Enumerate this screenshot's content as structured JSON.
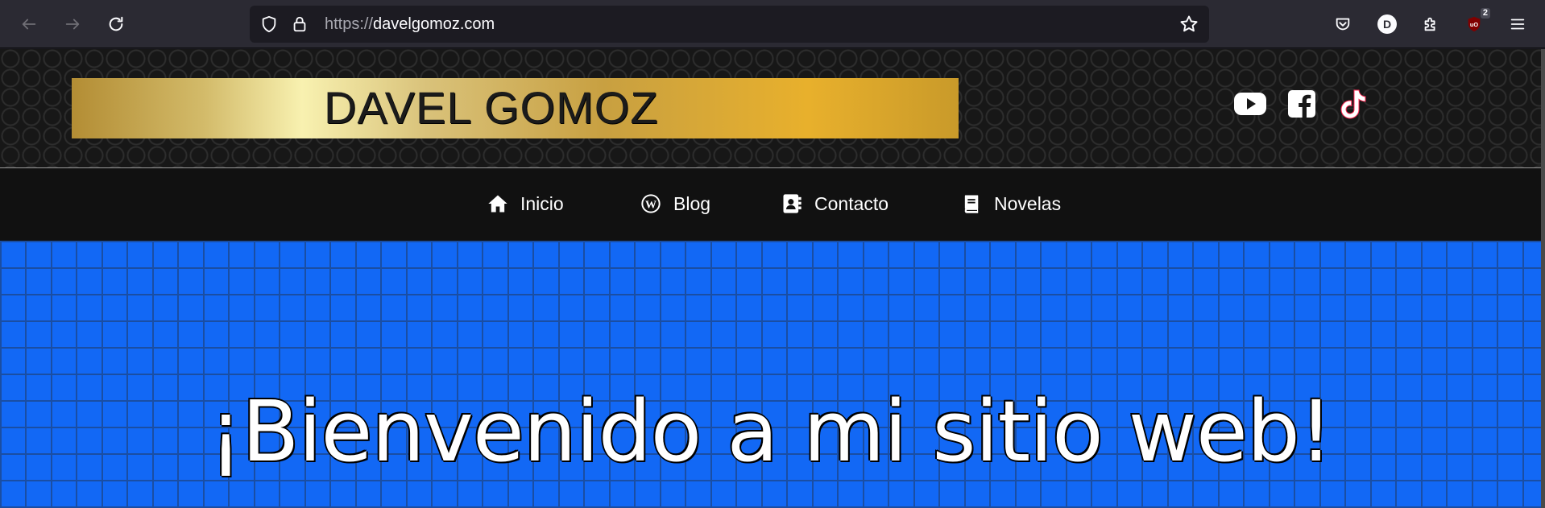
{
  "browser": {
    "url_protocol": "https://",
    "url_host": "davelgomoz.com",
    "account_initial": "D",
    "extension_badge": "2"
  },
  "site": {
    "logo_text": "DAVEL GOMOZ",
    "socials": [
      "youtube-icon",
      "facebook-icon",
      "tiktok-icon"
    ],
    "nav": [
      {
        "label": "Inicio",
        "icon": "home-icon"
      },
      {
        "label": "Blog",
        "icon": "wordpress-icon"
      },
      {
        "label": "Contacto",
        "icon": "address-book-icon"
      },
      {
        "label": "Novelas",
        "icon": "book-icon"
      }
    ],
    "hero_title": "¡Bienvenido a mi sitio web!"
  },
  "colors": {
    "chrome_bg": "#2b2a33",
    "url_bg": "#1c1b22",
    "header_bg": "#171717",
    "nav_bg": "#111111",
    "hero_bg": "#1268f5",
    "logo_gold": "#e8b02c"
  }
}
